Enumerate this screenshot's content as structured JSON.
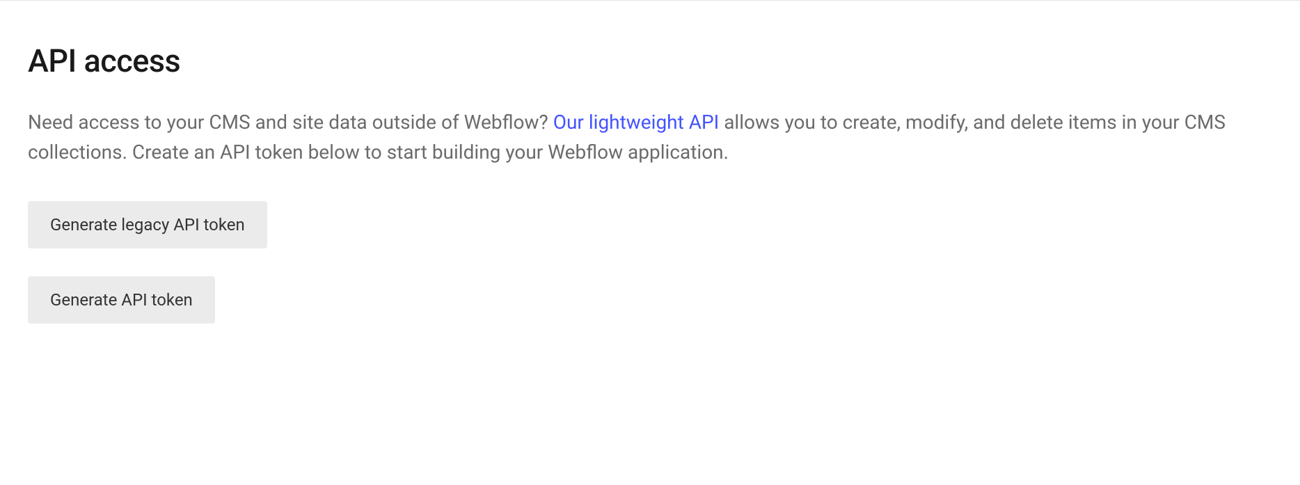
{
  "section": {
    "title": "API access",
    "description_before_link": "Need access to your CMS and site data outside of Webflow? ",
    "link_text": "Our lightweight API",
    "description_after_link": " allows you to create, modify, and delete items in your CMS collections. Create an API token below to start building your Webflow application."
  },
  "buttons": {
    "generate_legacy_label": "Generate legacy API token",
    "generate_label": "Generate API token"
  },
  "colors": {
    "link": "#4353ff",
    "text_primary": "#1a1a1a",
    "text_secondary": "#6b6b6b",
    "button_bg": "#ebebeb"
  }
}
